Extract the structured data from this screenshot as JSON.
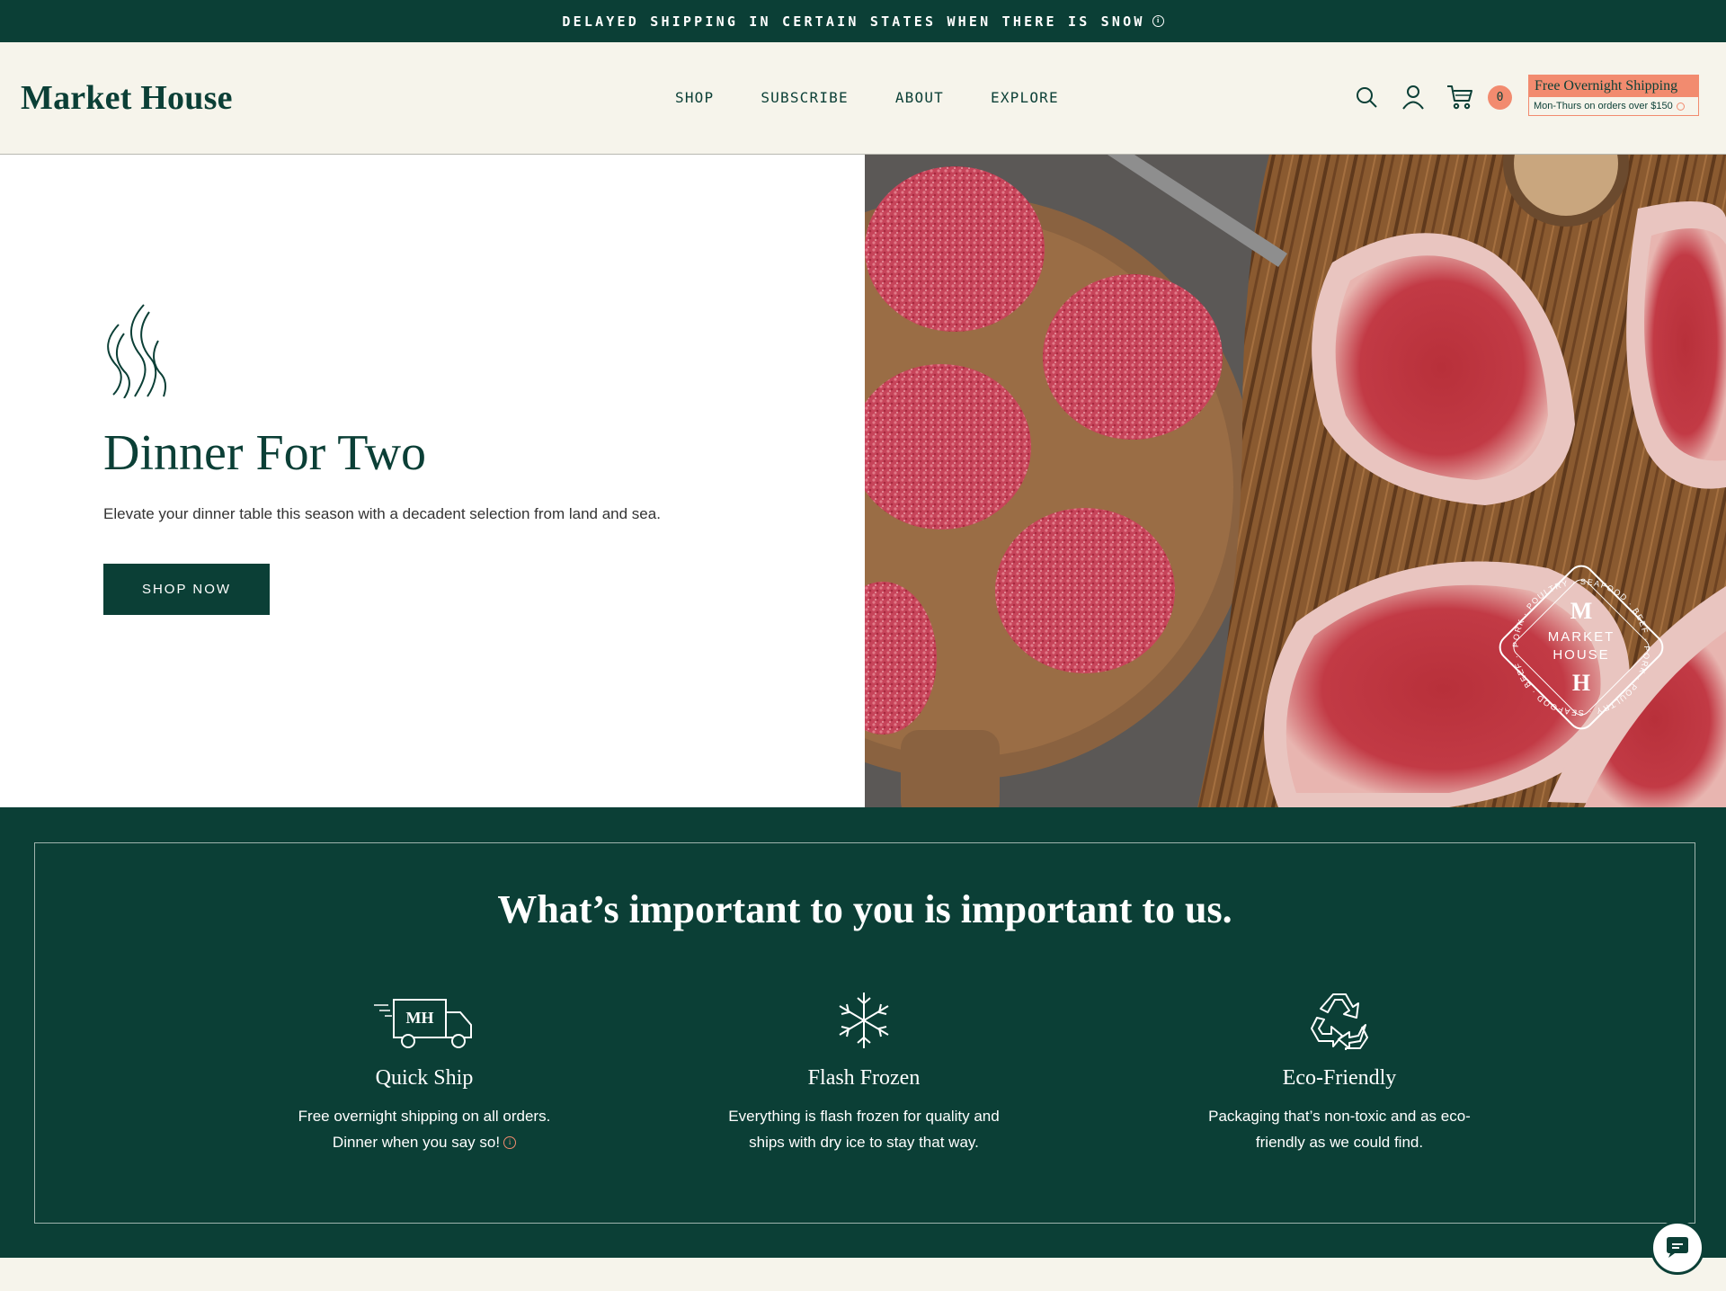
{
  "announcement": {
    "text": "DELAYED SHIPPING IN CERTAIN STATES WHEN THERE IS SNOW",
    "icon": "info-icon"
  },
  "header": {
    "logo": "Market House",
    "nav": [
      "SHOP",
      "SUBSCRIBE",
      "ABOUT",
      "EXPLORE"
    ],
    "cart_count": "0",
    "promo_title": "Free Overnight Shipping",
    "promo_sub": "Mon-Thurs on orders over $150"
  },
  "hero": {
    "title": "Dinner For Two",
    "subtitle": "Elevate your dinner table this season with a decadent selection from land and sea.",
    "cta": "SHOP NOW",
    "badge_monogram_top": "M",
    "badge_name_1": "MARKET",
    "badge_name_2": "HOUSE",
    "badge_monogram_bottom": "H",
    "badge_ring_text": "PORK · POULTRY · SEAFOOD · BEEF · PORK · POULTRY · SEAFOOD · BEEF ·"
  },
  "values": {
    "title": "What’s important to you is important to us.",
    "features": [
      {
        "icon": "delivery-truck-icon",
        "truck_label": "MH",
        "title": "Quick Ship",
        "line1": "Free overnight shipping on all orders.",
        "line2": "Dinner when you say so!"
      },
      {
        "icon": "snowflake-icon",
        "title": "Flash Frozen",
        "line1": "Everything is flash frozen for quality and",
        "line2": "ships with dry ice to stay that way."
      },
      {
        "icon": "recycle-icon",
        "title": "Eco-Friendly",
        "line1": "Packaging that’s non-toxic and as eco-",
        "line2": "friendly as we could find."
      }
    ]
  },
  "colors": {
    "brand_green": "#0b3f36",
    "accent_coral": "#f28b6f",
    "cream": "#f6f4eb"
  }
}
